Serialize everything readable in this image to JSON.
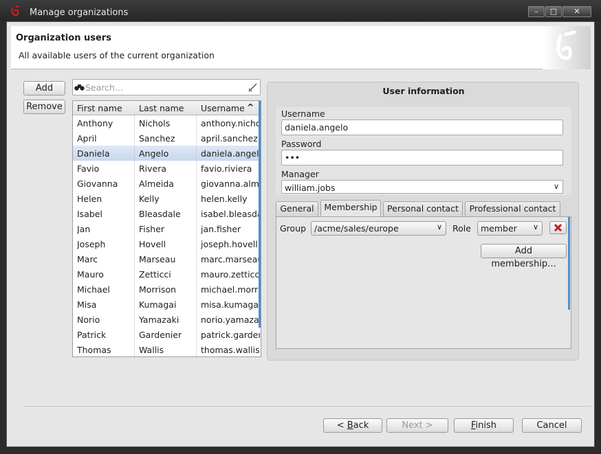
{
  "window": {
    "title": "Manage organizations",
    "controls": {
      "minimize": "–",
      "maximize": "□",
      "close": "✕"
    }
  },
  "banner": {
    "title": "Organization users",
    "subtitle": "All available users of the current organization"
  },
  "left": {
    "add_label": "Add",
    "remove_label": "Remove",
    "search_placeholder": "Search...",
    "columns": [
      "First name",
      "Last name",
      "Username"
    ],
    "sort_indicator": "^",
    "rows": [
      [
        "Anthony",
        "Nichols",
        "anthony.nichols"
      ],
      [
        "April",
        "Sanchez",
        "april.sanchez"
      ],
      [
        "Daniela",
        "Angelo",
        "daniela.angelo"
      ],
      [
        "Favio",
        "Rivera",
        "favio.riviera"
      ],
      [
        "Giovanna",
        "Almeida",
        "giovanna.almeida"
      ],
      [
        "Helen",
        "Kelly",
        "helen.kelly"
      ],
      [
        "Isabel",
        "Bleasdale",
        "isabel.bleasdale"
      ],
      [
        "Jan",
        "Fisher",
        "jan.fisher"
      ],
      [
        "Joseph",
        "Hovell",
        "joseph.hovell"
      ],
      [
        "Marc",
        "Marseau",
        "marc.marseau"
      ],
      [
        "Mauro",
        "Zetticci",
        "mauro.zetticci"
      ],
      [
        "Michael",
        "Morrison",
        "michael.morrison"
      ],
      [
        "Misa",
        "Kumagai",
        "misa.kumagai"
      ],
      [
        "Norio",
        "Yamazaki",
        "norio.yamazaki"
      ],
      [
        "Patrick",
        "Gardenier",
        "patrick.gardenier"
      ],
      [
        "Thomas",
        "Wallis",
        "thomas.wallis"
      ]
    ],
    "selected_row": 2
  },
  "user_info": {
    "title": "User information",
    "username_label": "Username",
    "username_value": "daniela.angelo",
    "password_label": "Password",
    "password_value": "•••",
    "manager_label": "Manager",
    "manager_value": "william.jobs",
    "tabs": [
      "General",
      "Membership",
      "Personal contact",
      "Professional contact"
    ],
    "active_tab": 1,
    "membership": {
      "group_label": "Group",
      "group_value": "/acme/sales/europe",
      "role_label": "Role",
      "role_value": "member",
      "add_label": "Add membership..."
    }
  },
  "footer": {
    "back_pre": "< ",
    "back_key": "B",
    "back_rest": "ack",
    "next_label": "Next >",
    "finish_key": "F",
    "finish_rest": "inish",
    "cancel_label": "Cancel"
  },
  "colors": {
    "selection": "#c9d9ee",
    "scroll_accent": "#4a8fd6",
    "delete_red": "#c21b1b",
    "logo_red": "#c8202a"
  }
}
